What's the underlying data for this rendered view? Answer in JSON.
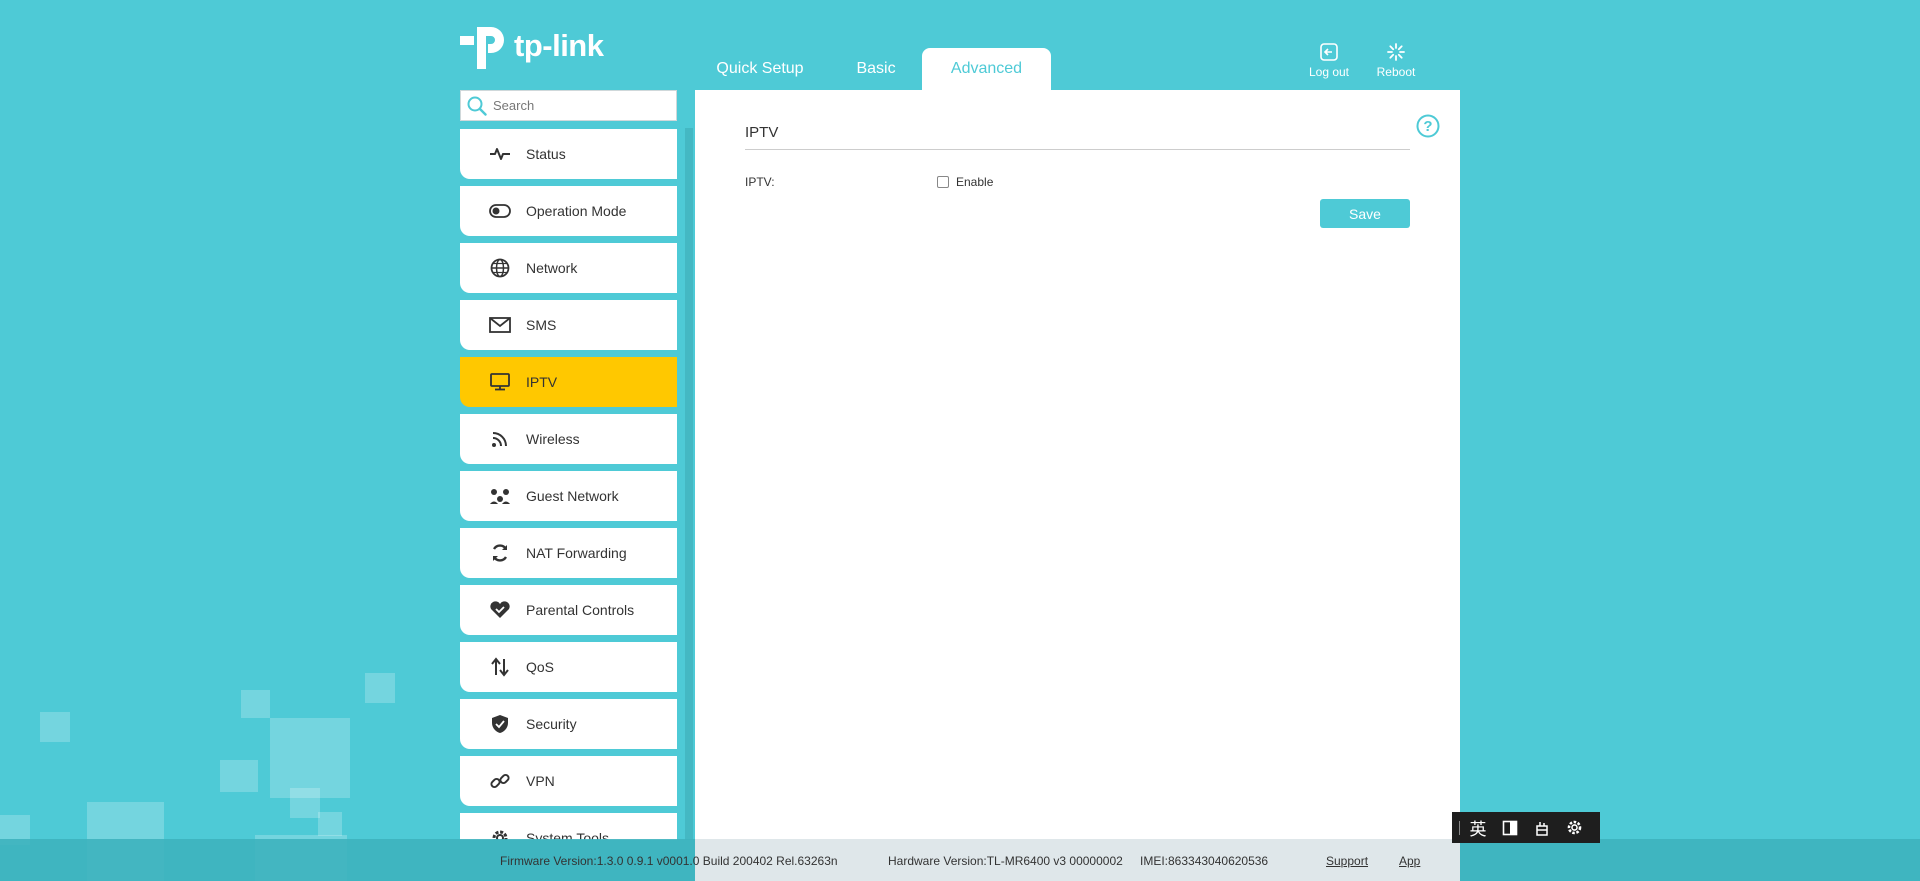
{
  "brand": {
    "logo_text": "tp-link"
  },
  "top_tabs": [
    {
      "label": "Quick Setup"
    },
    {
      "label": "Basic"
    },
    {
      "label": "Advanced"
    }
  ],
  "top_actions": {
    "logout_label": "Log out",
    "reboot_label": "Reboot"
  },
  "search": {
    "placeholder": "Search"
  },
  "sidebar": {
    "items": [
      {
        "label": "Status",
        "icon": "pulse-icon"
      },
      {
        "label": "Operation Mode",
        "icon": "toggle-icon"
      },
      {
        "label": "Network",
        "icon": "globe-icon"
      },
      {
        "label": "SMS",
        "icon": "envelope-icon"
      },
      {
        "label": "IPTV",
        "icon": "monitor-icon",
        "active": true
      },
      {
        "label": "Wireless",
        "icon": "wifi-icon"
      },
      {
        "label": "Guest Network",
        "icon": "guest-icon"
      },
      {
        "label": "NAT Forwarding",
        "icon": "refresh-icon"
      },
      {
        "label": "Parental Controls",
        "icon": "heart-icon"
      },
      {
        "label": "QoS",
        "icon": "updown-arrows-icon"
      },
      {
        "label": "Security",
        "icon": "shield-icon"
      },
      {
        "label": "VPN",
        "icon": "link-icon"
      },
      {
        "label": "System Tools",
        "icon": "gear-icon"
      }
    ]
  },
  "main": {
    "title": "IPTV",
    "iptv_label": "IPTV:",
    "enable_label": "Enable",
    "enable_checked": false,
    "save_label": "Save"
  },
  "footer": {
    "firmware": "Firmware Version:1.3.0 0.9.1 v0001.0 Build 200402 Rel.63263n",
    "hardware": "Hardware Version:TL-MR6400 v3 00000002",
    "imei": "IMEI:863343040620536",
    "support_label": "Support",
    "app_label": "App"
  },
  "ime_toolbar": {
    "lang_label": "英"
  },
  "colors": {
    "accent": "#4ecad6",
    "active_menu": "#ffc800"
  }
}
